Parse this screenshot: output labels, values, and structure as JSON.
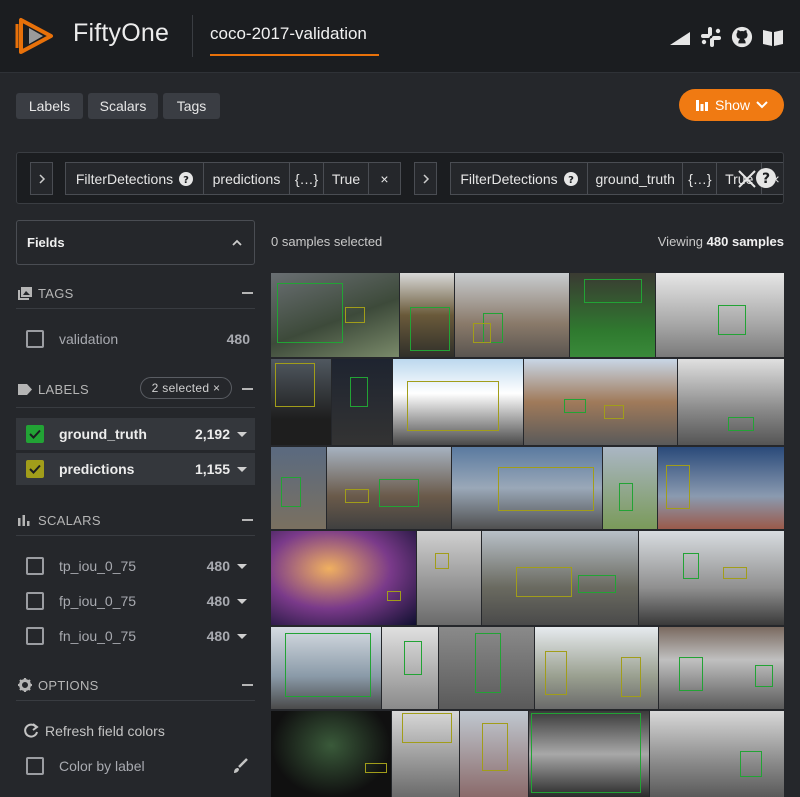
{
  "app": {
    "brand": "FiftyOne",
    "dataset": "coco-2017-validation"
  },
  "colors": {
    "accent": "#f07a12",
    "ground_truth": "#22a335",
    "predictions": "#a19d1a"
  },
  "header_icons": [
    "signal-icon",
    "slack-icon",
    "github-icon",
    "docs-book-icon"
  ],
  "toolbar": {
    "labels_tab": "Labels",
    "scalars_tab": "Scalars",
    "tags_tab": "Tags",
    "show_button": "Show"
  },
  "filters": [
    {
      "stage": "FilterDetections",
      "field": "predictions",
      "expr": "{…}",
      "only_matches": "True",
      "remove": "×"
    },
    {
      "stage": "FilterDetections",
      "field": "ground_truth",
      "expr": "{…}",
      "only_matches": "True",
      "remove": "×"
    }
  ],
  "sidebar": {
    "fields_label": "Fields",
    "tags": {
      "title": "TAGS",
      "items": [
        {
          "label": "validation",
          "count": "480"
        }
      ]
    },
    "labels": {
      "title": "LABELS",
      "selected_badge": "2 selected ×",
      "items": [
        {
          "label": "ground_truth",
          "count": "2,192"
        },
        {
          "label": "predictions",
          "count": "1,155"
        }
      ]
    },
    "scalars": {
      "title": "SCALARS",
      "items": [
        {
          "label": "tp_iou_0_75",
          "count": "480"
        },
        {
          "label": "fp_iou_0_75",
          "count": "480"
        },
        {
          "label": "fn_iou_0_75",
          "count": "480"
        }
      ]
    },
    "options": {
      "title": "OPTIONS",
      "refresh": "Refresh field colors",
      "color_by_label": "Color by label"
    }
  },
  "main": {
    "selected_text": "0 samples selected",
    "viewing_prefix": "Viewing ",
    "viewing_count": "480 samples"
  }
}
